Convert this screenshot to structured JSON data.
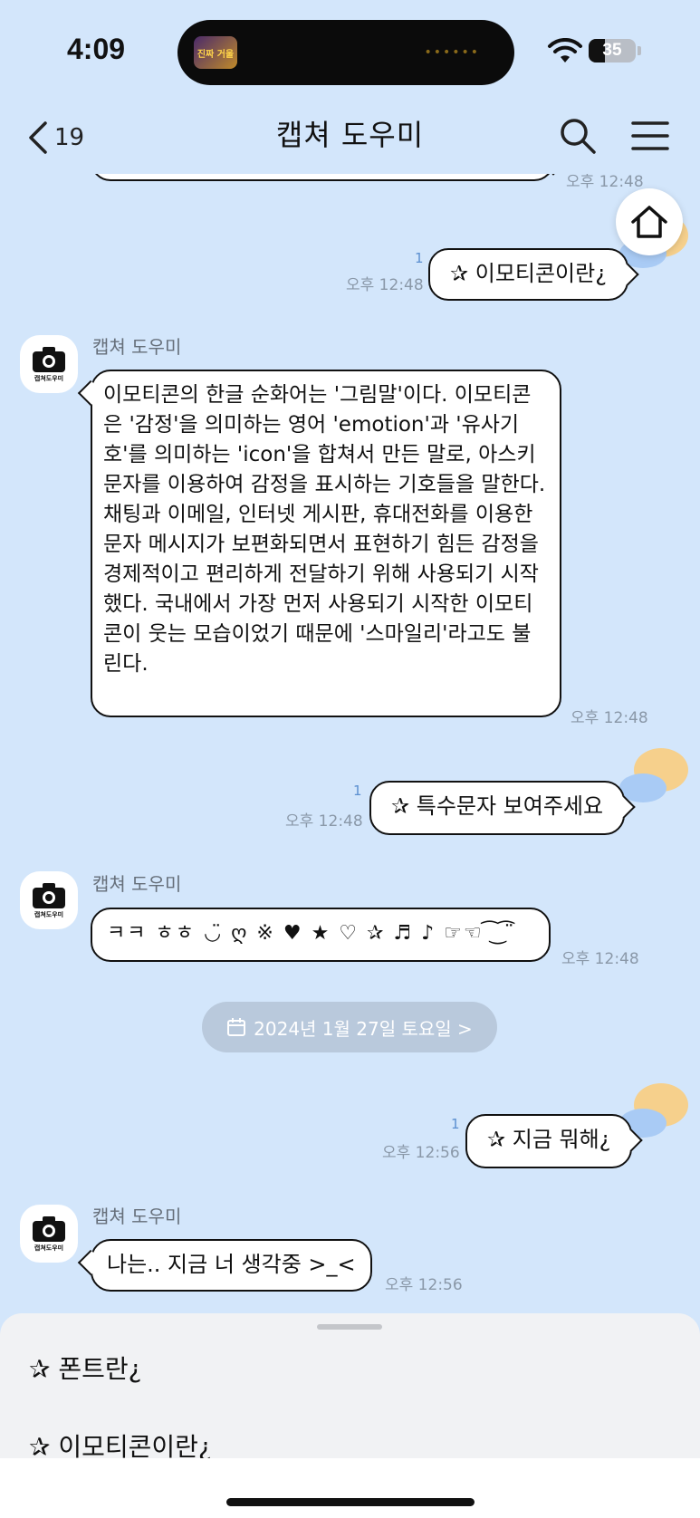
{
  "status_bar": {
    "time": "4:09",
    "island_thumb_text": "진짜 거울",
    "battery_level": "35",
    "battery_fraction": 0.35
  },
  "header": {
    "back_count": "19",
    "title": "캡쳐 도우미"
  },
  "sender_name": "캡쳐 도우미",
  "avatar_label": "캡쳐도우미",
  "messages": {
    "m0_time": "오후 12:48",
    "m1": {
      "text": "✰ 이모티콘이란¿",
      "read": "1",
      "time": "오후 12:48"
    },
    "m2": {
      "text": "이모티콘의 한글 순화어는 '그림말'이다. 이모티콘은 '감정'을 의미하는 영어 'emotion'과 '유사기호'를 의미하는 'icon'을 합쳐서 만든 말로, 아스키 문자를 이용하여 감정을 표시하는 기호들을 말한다. 채팅과 이메일, 인터넷 게시판, 휴대전화를 이용한 문자 메시지가 보편화되면서 표현하기 힘든 감정을 경제적이고 편리하게 전달하기 위해 사용되기 시작했다. 국내에서 가장 먼저 사용되기 시작한 이모티콘이 웃는 모습이었기 때문에 '스마일리'라고도 불린다.",
      "time": "오후 12:48"
    },
    "m3": {
      "text": "✰ 특수문자 보여주세요",
      "read": "1",
      "time": "오후 12:48"
    },
    "m4": {
      "text": "ㅋㅋ ㅎㅎ ◡̈ ღ ※ ♥ ★ ♡ ✰ ♬ ♪ ☞☜ ͡ ͜ ͡ ̈",
      "time": "오후 12:48"
    },
    "m5": {
      "text": "✰ 지금 뭐해¿",
      "read": "1",
      "time": "오후 12:56"
    },
    "m6": {
      "text": "나는.. 지금 너 생각중 >_<",
      "time": "오후 12:56"
    }
  },
  "date_divider": "2024년 1월 27일 토요일 >",
  "quick_replies": [
    "✰ 폰트란¿",
    "✰ 이모티콘이란¿"
  ],
  "icons": {
    "back": "chevron-left-icon",
    "search": "search-icon",
    "menu": "hamburger-menu-icon",
    "home": "home-icon",
    "calendar": "calendar-icon",
    "camera": "camera-icon",
    "wifi": "wifi-icon"
  },
  "colors": {
    "background": "#d3e6fb",
    "bubble": "#ffffff",
    "bubble_border": "#111111",
    "meta_text": "#8a98a8",
    "read_count": "#5b8fd0",
    "date_chip": "#b9c9dc",
    "sheet": "#f1f2f4"
  }
}
